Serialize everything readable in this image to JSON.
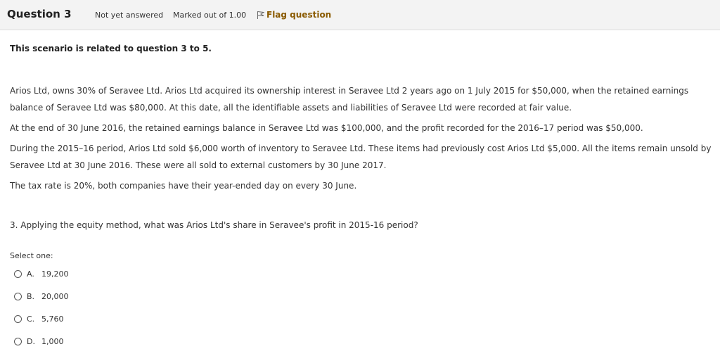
{
  "header": {
    "question_label": "Question",
    "question_number": "3",
    "status": "Not yet answered",
    "marks": "Marked out of 1.00",
    "flag_label": "Flag question"
  },
  "scenario": {
    "intro": "This scenario is related to question 3 to 5.",
    "paragraphs": [
      "Arios Ltd, owns 30% of Seravee Ltd. Arios Ltd acquired its ownership interest in Seravee Ltd 2 years ago on 1 July 2015 for $50,000, when the retained earnings balance of Seravee Ltd was $80,000. At this date, all the identifiable assets and liabilities of Seravee Ltd were recorded at fair value.",
      "At the end of 30 June 2016, the retained earnings balance in Seravee Ltd was $100,000, and the profit recorded for the 2016–17 period was $50,000.",
      "During the 2015–16 period, Arios Ltd sold $6,000 worth of inventory to Seravee Ltd. These items had previously cost Arios Ltd $5,000. All the items remain unsold by Seravee Ltd at 30 June 2016. These were all sold to external customers by 30 June 2017.",
      "The tax rate is 20%, both companies have their year-ended day on every 30 June."
    ]
  },
  "question": {
    "text": "3. Applying the equity method, what was Arios Ltd's share in Seravee's profit in 2015-16 period?",
    "select_label": "Select one:",
    "options": [
      {
        "letter": "A.",
        "value": "19,200"
      },
      {
        "letter": "B.",
        "value": "20,000"
      },
      {
        "letter": "C.",
        "value": "5,760"
      },
      {
        "letter": "D.",
        "value": "1,000"
      }
    ]
  },
  "colors": {
    "header_bg": "#f3f3f3",
    "flag_text": "#8a5a00"
  },
  "icons": {
    "flag": "flag-outline-icon",
    "radio": "radio-unchecked-icon"
  }
}
